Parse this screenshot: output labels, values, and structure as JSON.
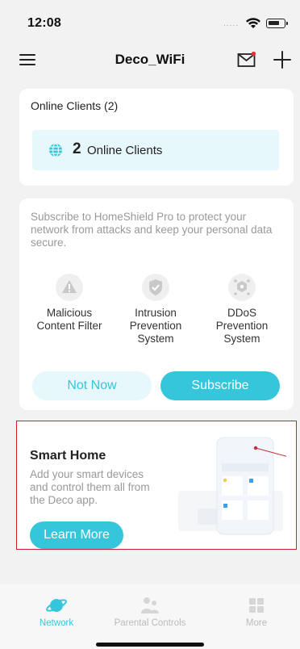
{
  "status_bar": {
    "time": "12:08",
    "dots": "....."
  },
  "header": {
    "title": "Deco_WiFi"
  },
  "online_card": {
    "title": "Online Clients (2)",
    "count": "2",
    "label": "Online Clients"
  },
  "homeshield_card": {
    "description": "Subscribe to HomeShield Pro to protect your network from attacks and keep your personal data secure.",
    "features": [
      {
        "label": "Malicious\nContent Filter",
        "icon": "warning-icon"
      },
      {
        "label": "Intrusion\nPrevention\nSystem",
        "icon": "shield-check-icon"
      },
      {
        "label": "DDoS\nPrevention\nSystem",
        "icon": "ddos-icon"
      }
    ],
    "not_now_label": "Not Now",
    "subscribe_label": "Subscribe"
  },
  "smart_home_card": {
    "title": "Smart Home",
    "description": "Add your smart devices\nand control them all from\nthe Deco app.",
    "button_label": "Learn More"
  },
  "tab_bar": {
    "tabs": [
      {
        "label": "Network",
        "icon": "planet-icon",
        "active": true
      },
      {
        "label": "Parental Controls",
        "icon": "family-icon",
        "active": false
      },
      {
        "label": "More",
        "icon": "grid-icon",
        "active": false
      }
    ]
  },
  "colors": {
    "accent": "#35c6dc",
    "accent_light": "#e6f8fb",
    "highlight_border": "#d21e2b",
    "background": "#f2f2f2"
  }
}
